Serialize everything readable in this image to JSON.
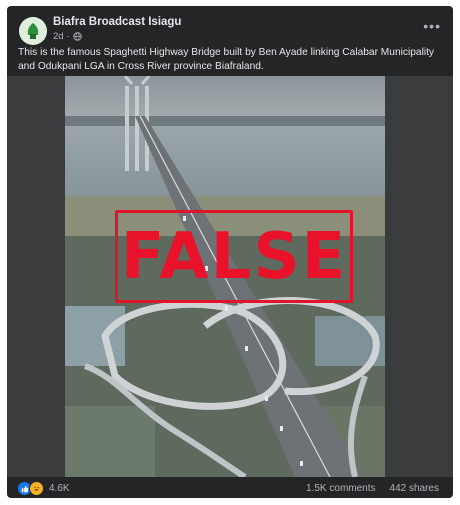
{
  "post": {
    "author": "Biafra Broadcast Isiagu",
    "time": "2d",
    "privacy_icon": "globe-icon",
    "caption": "This is the famous Spaghetti Highway Bridge built by Ben Ayade linking Calabar Municipality and Odukpani LGA in Cross River province Biafraland.",
    "stamp_text": "FALSE"
  },
  "stats": {
    "reaction_count": "4.6K",
    "comments": "1.5K comments",
    "shares": "442 shares"
  },
  "colors": {
    "card_bg": "#242526",
    "stamp_red": "#e0142a",
    "like_blue": "#1877f2"
  }
}
